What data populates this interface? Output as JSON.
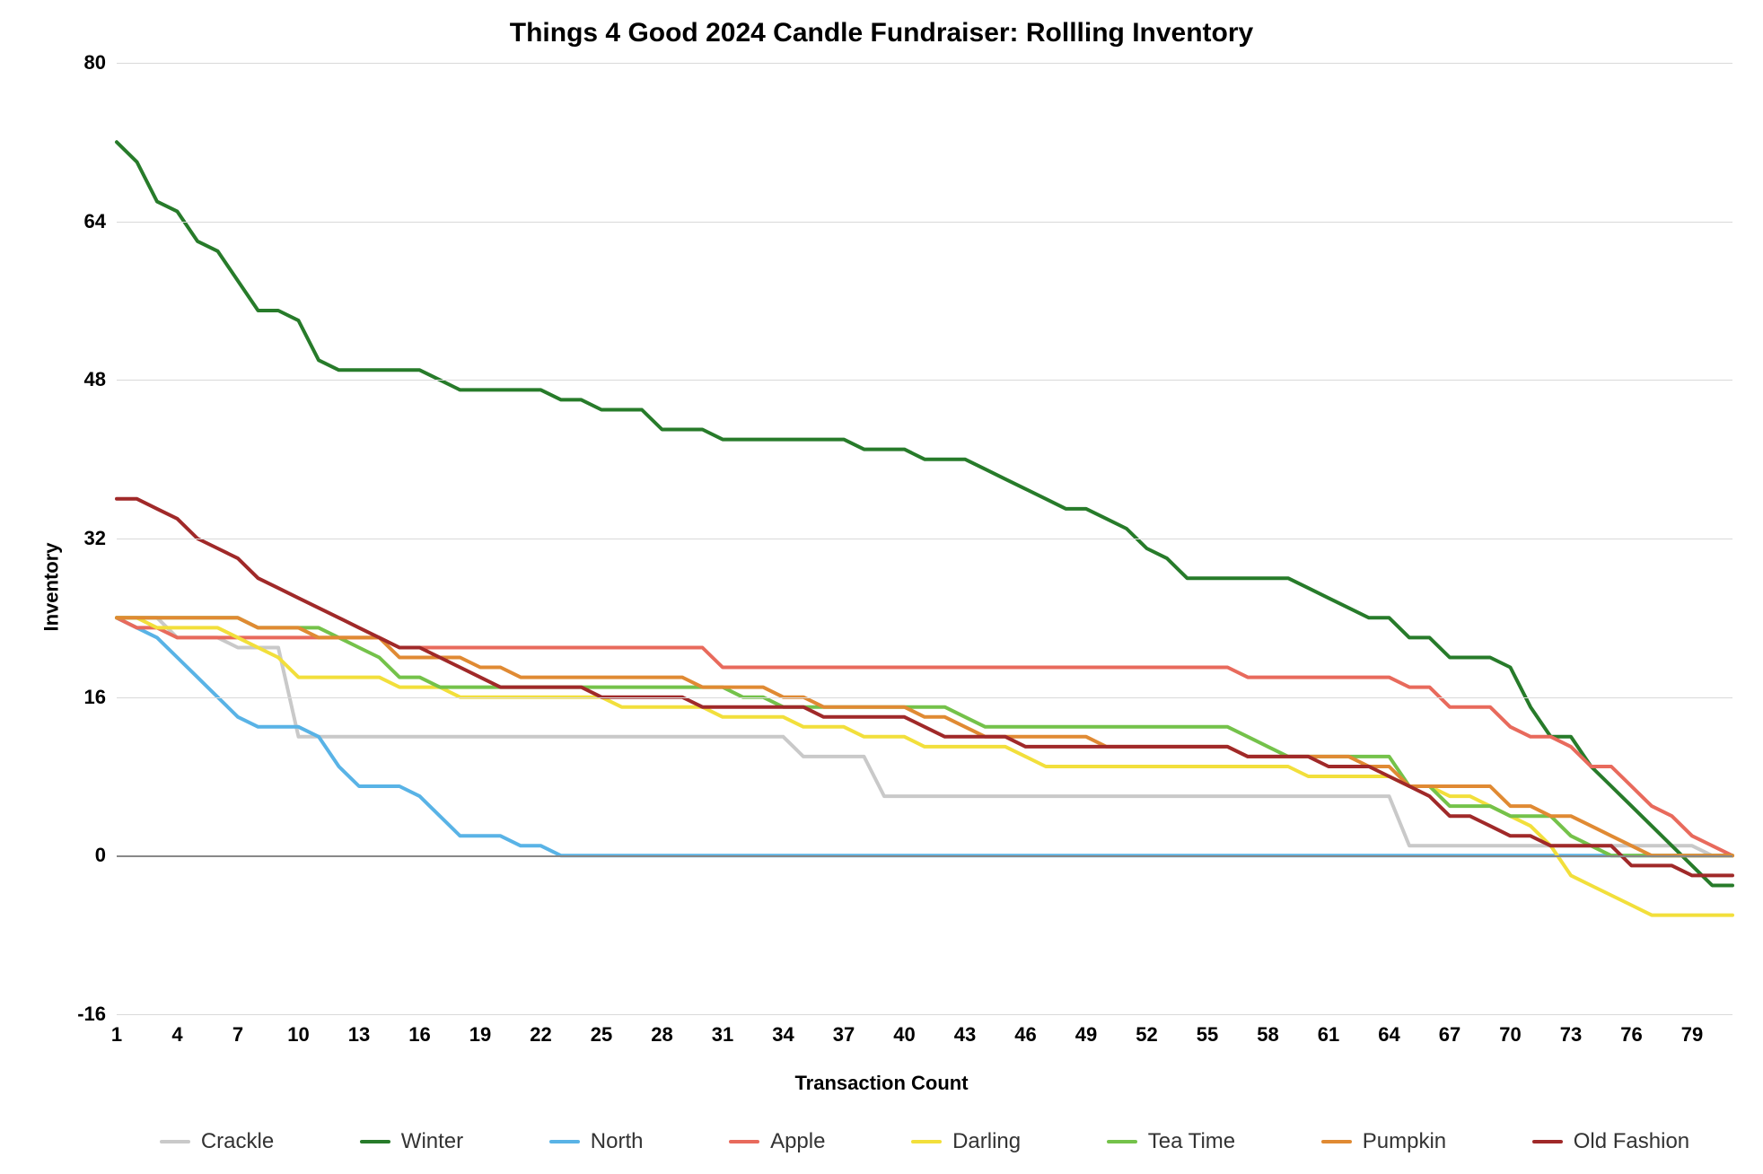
{
  "chart_data": {
    "type": "line",
    "title": "Things 4 Good 2024 Candle Fundraiser: Rollling Inventory",
    "xlabel": "Transaction Count",
    "ylabel": "Inventory",
    "ylim": [
      -16,
      80
    ],
    "yticks": [
      -16,
      0,
      16,
      32,
      48,
      64,
      80
    ],
    "x": [
      1,
      2,
      3,
      4,
      5,
      6,
      7,
      8,
      9,
      10,
      11,
      12,
      13,
      14,
      15,
      16,
      17,
      18,
      19,
      20,
      21,
      22,
      23,
      24,
      25,
      26,
      27,
      28,
      29,
      30,
      31,
      32,
      33,
      34,
      35,
      36,
      37,
      38,
      39,
      40,
      41,
      42,
      43,
      44,
      45,
      46,
      47,
      48,
      49,
      50,
      51,
      52,
      53,
      54,
      55,
      56,
      57,
      58,
      59,
      60,
      61,
      62,
      63,
      64,
      65,
      66,
      67,
      68,
      69,
      70,
      71,
      72,
      73,
      74,
      75,
      76,
      77,
      78,
      79,
      80,
      81
    ],
    "xticks": [
      1,
      4,
      7,
      10,
      13,
      16,
      19,
      22,
      25,
      28,
      31,
      34,
      37,
      40,
      43,
      46,
      49,
      52,
      55,
      58,
      61,
      64,
      67,
      70,
      73,
      76,
      79
    ],
    "series": [
      {
        "name": "Crackle",
        "color": "#c9c9c9",
        "values": [
          24,
          24,
          24,
          22,
          22,
          22,
          21,
          21,
          21,
          12,
          12,
          12,
          12,
          12,
          12,
          12,
          12,
          12,
          12,
          12,
          12,
          12,
          12,
          12,
          12,
          12,
          12,
          12,
          12,
          12,
          12,
          12,
          12,
          12,
          10,
          10,
          10,
          10,
          6,
          6,
          6,
          6,
          6,
          6,
          6,
          6,
          6,
          6,
          6,
          6,
          6,
          6,
          6,
          6,
          6,
          6,
          6,
          6,
          6,
          6,
          6,
          6,
          6,
          6,
          1,
          1,
          1,
          1,
          1,
          1,
          1,
          1,
          1,
          1,
          1,
          1,
          1,
          1,
          1,
          0,
          0
        ]
      },
      {
        "name": "Winter",
        "color": "#277b2a",
        "values": [
          72,
          70,
          66,
          65,
          62,
          61,
          58,
          55,
          55,
          54,
          50,
          49,
          49,
          49,
          49,
          49,
          48,
          47,
          47,
          47,
          47,
          47,
          46,
          46,
          45,
          45,
          45,
          43,
          43,
          43,
          42,
          42,
          42,
          42,
          42,
          42,
          42,
          41,
          41,
          41,
          40,
          40,
          40,
          39,
          38,
          37,
          36,
          35,
          35,
          34,
          33,
          31,
          30,
          28,
          28,
          28,
          28,
          28,
          28,
          27,
          26,
          25,
          24,
          24,
          22,
          22,
          20,
          20,
          20,
          19,
          15,
          12,
          12,
          9,
          7,
          5,
          3,
          1,
          -1,
          -3,
          -3
        ]
      },
      {
        "name": "North",
        "color": "#59b3e6",
        "values": [
          24,
          23,
          22,
          20,
          18,
          16,
          14,
          13,
          13,
          13,
          12,
          9,
          7,
          7,
          7,
          6,
          4,
          2,
          2,
          2,
          1,
          1,
          0,
          0,
          0,
          0,
          0,
          0,
          0,
          0,
          0,
          0,
          0,
          0,
          0,
          0,
          0,
          0,
          0,
          0,
          0,
          0,
          0,
          0,
          0,
          0,
          0,
          0,
          0,
          0,
          0,
          0,
          0,
          0,
          0,
          0,
          0,
          0,
          0,
          0,
          0,
          0,
          0,
          0,
          0,
          0,
          0,
          0,
          0,
          0,
          0,
          0,
          0,
          0,
          0,
          0,
          0,
          0,
          0,
          0,
          0
        ]
      },
      {
        "name": "Apple",
        "color": "#e86a5c",
        "values": [
          24,
          23,
          23,
          22,
          22,
          22,
          22,
          22,
          22,
          22,
          22,
          22,
          22,
          22,
          21,
          21,
          21,
          21,
          21,
          21,
          21,
          21,
          21,
          21,
          21,
          21,
          21,
          21,
          21,
          21,
          19,
          19,
          19,
          19,
          19,
          19,
          19,
          19,
          19,
          19,
          19,
          19,
          19,
          19,
          19,
          19,
          19,
          19,
          19,
          19,
          19,
          19,
          19,
          19,
          19,
          19,
          18,
          18,
          18,
          18,
          18,
          18,
          18,
          18,
          17,
          17,
          15,
          15,
          15,
          13,
          12,
          12,
          11,
          9,
          9,
          7,
          5,
          4,
          2,
          1,
          0
        ]
      },
      {
        "name": "Darling",
        "color": "#f2df3b",
        "values": [
          24,
          24,
          23,
          23,
          23,
          23,
          22,
          21,
          20,
          18,
          18,
          18,
          18,
          18,
          17,
          17,
          17,
          16,
          16,
          16,
          16,
          16,
          16,
          16,
          16,
          15,
          15,
          15,
          15,
          15,
          14,
          14,
          14,
          14,
          13,
          13,
          13,
          12,
          12,
          12,
          11,
          11,
          11,
          11,
          11,
          10,
          9,
          9,
          9,
          9,
          9,
          9,
          9,
          9,
          9,
          9,
          9,
          9,
          9,
          8,
          8,
          8,
          8,
          8,
          7,
          7,
          6,
          6,
          5,
          4,
          3,
          1,
          -2,
          -3,
          -4,
          -5,
          -6,
          -6,
          -6,
          -6,
          -6
        ]
      },
      {
        "name": "Tea Time",
        "color": "#74c24a",
        "values": [
          24,
          24,
          24,
          24,
          24,
          24,
          24,
          23,
          23,
          23,
          23,
          22,
          21,
          20,
          18,
          18,
          17,
          17,
          17,
          17,
          17,
          17,
          17,
          17,
          17,
          17,
          17,
          17,
          17,
          17,
          17,
          16,
          16,
          15,
          15,
          15,
          15,
          15,
          15,
          15,
          15,
          15,
          14,
          13,
          13,
          13,
          13,
          13,
          13,
          13,
          13,
          13,
          13,
          13,
          13,
          13,
          12,
          11,
          10,
          10,
          10,
          10,
          10,
          10,
          7,
          7,
          5,
          5,
          5,
          4,
          4,
          4,
          2,
          1,
          0,
          0,
          0,
          0,
          0,
          0,
          0
        ]
      },
      {
        "name": "Pumpkin",
        "color": "#e08a33",
        "values": [
          24,
          24,
          24,
          24,
          24,
          24,
          24,
          23,
          23,
          23,
          22,
          22,
          22,
          22,
          20,
          20,
          20,
          20,
          19,
          19,
          18,
          18,
          18,
          18,
          18,
          18,
          18,
          18,
          18,
          17,
          17,
          17,
          17,
          16,
          16,
          15,
          15,
          15,
          15,
          15,
          14,
          14,
          13,
          12,
          12,
          12,
          12,
          12,
          12,
          11,
          11,
          11,
          11,
          11,
          11,
          11,
          10,
          10,
          10,
          10,
          10,
          10,
          9,
          9,
          7,
          7,
          7,
          7,
          7,
          5,
          5,
          4,
          4,
          3,
          2,
          1,
          0,
          0,
          0,
          0,
          0
        ]
      },
      {
        "name": "Old Fashion",
        "color": "#a02929",
        "values": [
          36,
          36,
          35,
          34,
          32,
          31,
          30,
          28,
          27,
          26,
          25,
          24,
          23,
          22,
          21,
          21,
          20,
          19,
          18,
          17,
          17,
          17,
          17,
          17,
          16,
          16,
          16,
          16,
          16,
          15,
          15,
          15,
          15,
          15,
          15,
          14,
          14,
          14,
          14,
          14,
          13,
          12,
          12,
          12,
          12,
          11,
          11,
          11,
          11,
          11,
          11,
          11,
          11,
          11,
          11,
          11,
          10,
          10,
          10,
          10,
          9,
          9,
          9,
          8,
          7,
          6,
          4,
          4,
          3,
          2,
          2,
          1,
          1,
          1,
          1,
          -1,
          -1,
          -1,
          -2,
          -2,
          -2
        ]
      }
    ]
  }
}
